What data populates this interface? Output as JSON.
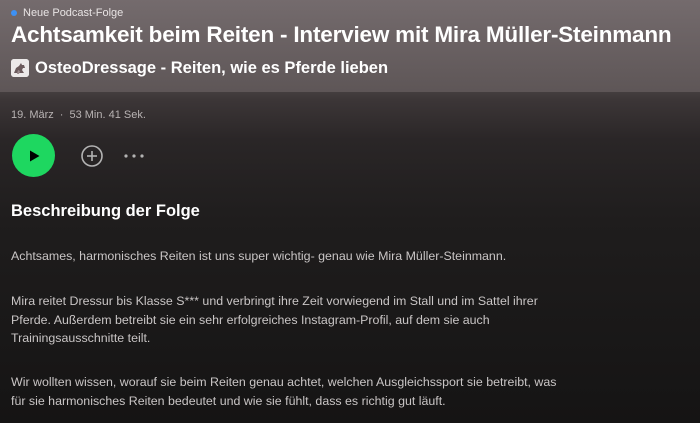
{
  "header": {
    "badge": "Neue Podcast-Folge",
    "episode_title": "Achtsamkeit beim Reiten - Interview mit Mira Müller-Steinmann",
    "show_title": "OsteoDressage - Reiten, wie es Pferde lieben"
  },
  "meta": {
    "date": "19. März",
    "separator": "·",
    "duration": "53 Min. 41 Sek."
  },
  "controls": {
    "play_icon": "play-icon",
    "add_icon": "add-circle-icon",
    "more_icon": "more-dots-icon"
  },
  "description": {
    "heading": "Beschreibung der Folge",
    "paragraphs": [
      "Achtsames, harmonisches Reiten ist uns super wichtig- genau wie Mira Müller-Steinmann.",
      "Mira reitet Dressur bis Klasse S*** und verbringt ihre Zeit vorwiegend im Stall und im Sattel ihrer Pferde. Außerdem betreibt sie ein sehr erfolgreiches Instagram-Profil, auf dem sie auch Trainingsausschnitte teilt.",
      "Wir wollten wissen, worauf sie beim Reiten genau achtet, welchen Ausgleichssport sie betreibt, was für sie harmonisches Reiten bedeutet und wie sie fühlt, dass es richtig gut läuft."
    ]
  },
  "colors": {
    "accent_green": "#1ed760",
    "new_dot_blue": "#3d91f4",
    "header_bg": "#6f6668",
    "body_bg": "#151414"
  }
}
